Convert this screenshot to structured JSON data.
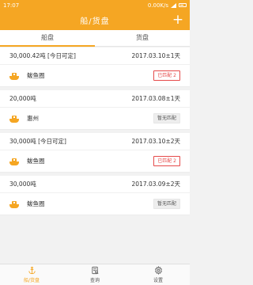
{
  "status_bar": {
    "time": "17:07",
    "network": "0.00K/s"
  },
  "header": {
    "title": "船/货盘",
    "add_label": "+"
  },
  "tabs": [
    {
      "label": "船盘",
      "active": true
    },
    {
      "label": "货盘",
      "active": false
    }
  ],
  "cards": [
    {
      "weight": "30,000.42吨 [今日可定]",
      "date": "2017.03.10±1天",
      "port": "鲅鱼圈",
      "badge": "已匹配 2",
      "badge_type": "matched"
    },
    {
      "weight": "20,000吨",
      "date": "2017.03.08±1天",
      "port": "惠州",
      "badge": "暂无匹配",
      "badge_type": "unmatched"
    },
    {
      "weight": "30,000吨 [今日可定]",
      "date": "2017.03.10±2天",
      "port": "鲅鱼圈",
      "badge": "已匹配 2",
      "badge_type": "matched"
    },
    {
      "weight": "30,000吨",
      "date": "2017.03.09±2天",
      "port": "鲅鱼圈",
      "badge": "暂无匹配",
      "badge_type": "unmatched"
    }
  ],
  "bottom_nav": [
    {
      "label": "船/货盘",
      "icon": "anchor-icon",
      "active": true
    },
    {
      "label": "查询",
      "icon": "document-search-icon",
      "active": false
    },
    {
      "label": "设置",
      "icon": "gear-icon",
      "active": false
    }
  ],
  "colors": {
    "accent": "#f5a623",
    "matched": "#e64a4a"
  }
}
